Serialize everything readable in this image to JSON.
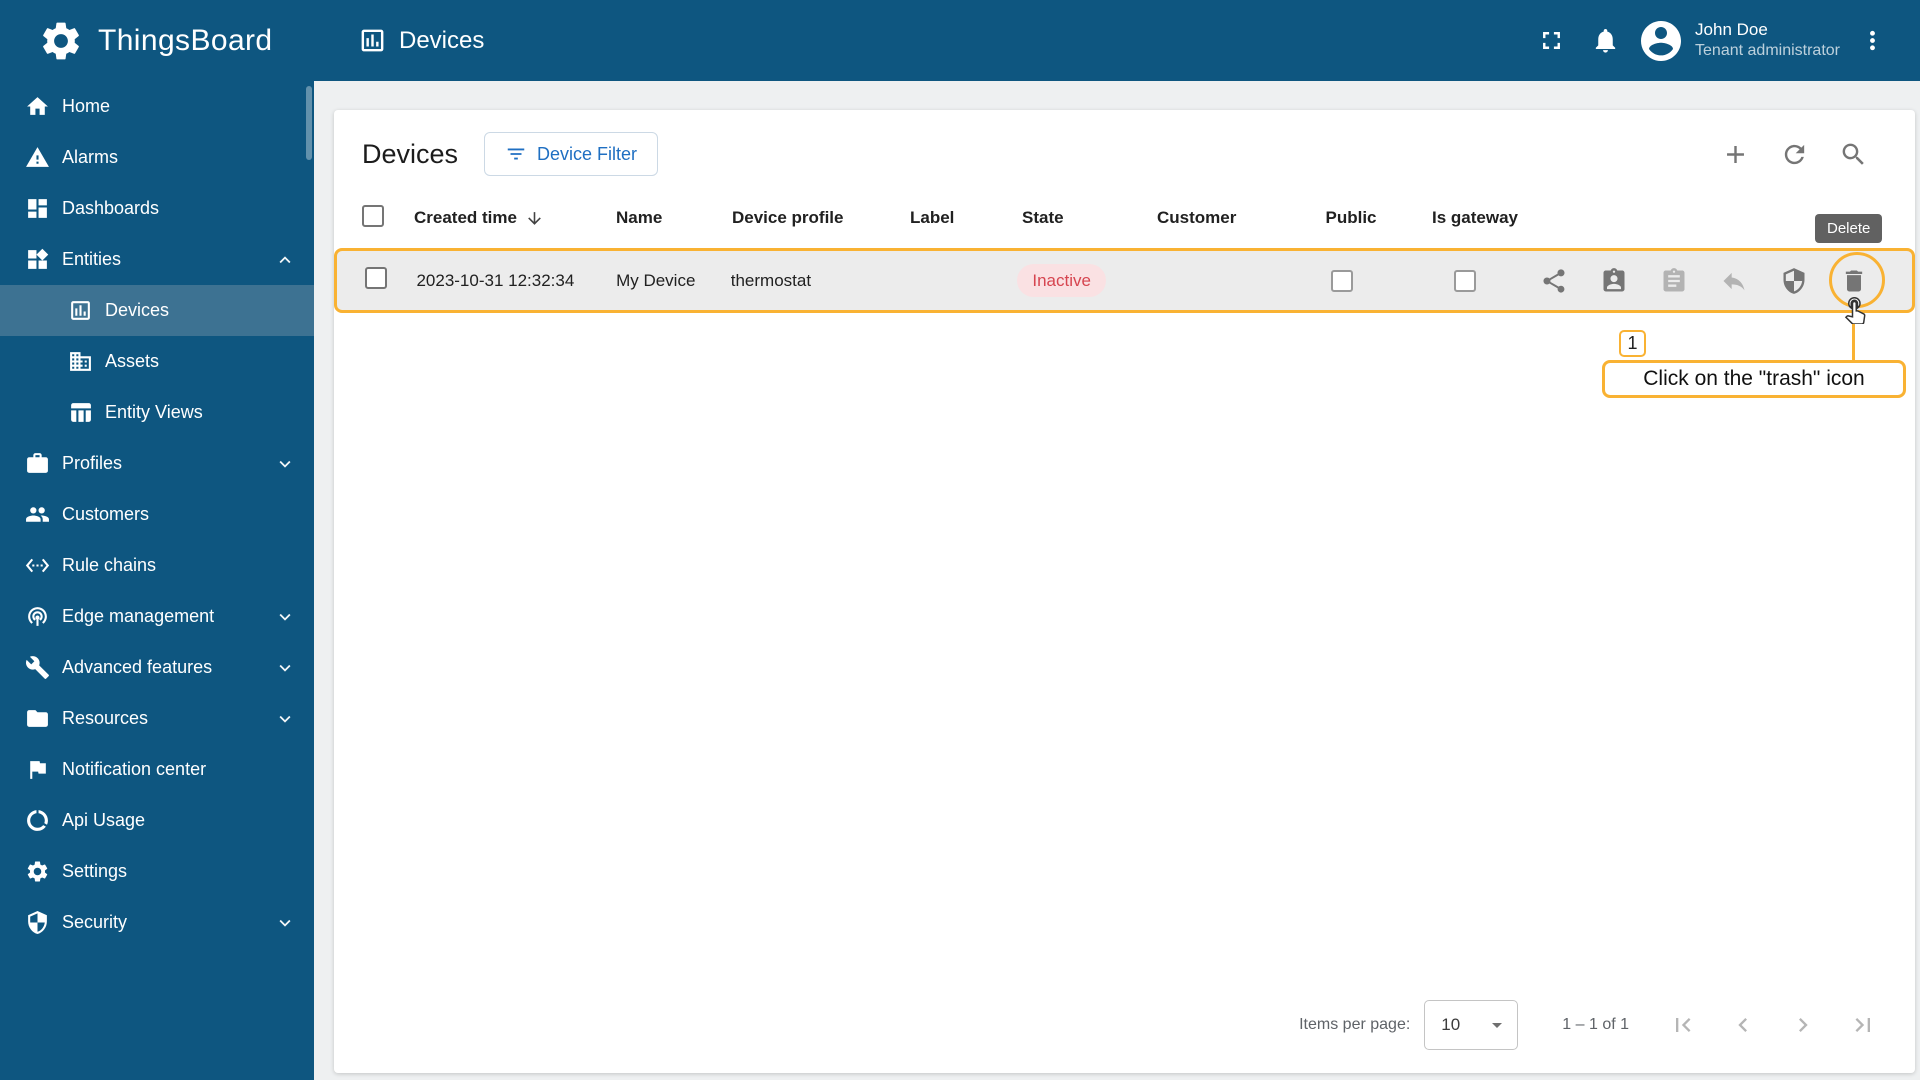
{
  "theme": {
    "primary": "#0e5680",
    "sidebar_selected": "#3d7292",
    "annotation_accent": "#f9b233",
    "state_inactive_bg": "#fae1e3",
    "state_inactive_text": "#d64550",
    "tooltip_bg": "#616161",
    "filter_button_text": "#1f6fc2"
  },
  "app": {
    "name": "ThingsBoard"
  },
  "topbar": {
    "title": "Devices",
    "user": {
      "name": "John Doe",
      "role": "Tenant administrator"
    },
    "icons": [
      "fullscreen-icon",
      "notifications-icon",
      "account-avatar-icon",
      "more-menu-icon"
    ]
  },
  "sidebar": {
    "items": [
      {
        "label": "Home",
        "icon": "home-icon"
      },
      {
        "label": "Alarms",
        "icon": "alarms-icon"
      },
      {
        "label": "Dashboards",
        "icon": "dashboards-icon"
      },
      {
        "label": "Entities",
        "icon": "entities-icon",
        "expanded": true
      },
      {
        "label": "Devices",
        "icon": "devices-icon",
        "child": true,
        "selected": true
      },
      {
        "label": "Assets",
        "icon": "assets-icon",
        "child": true
      },
      {
        "label": "Entity Views",
        "icon": "entity-views-icon",
        "child": true
      },
      {
        "label": "Profiles",
        "icon": "profiles-icon",
        "collapsible": true
      },
      {
        "label": "Customers",
        "icon": "customers-icon"
      },
      {
        "label": "Rule chains",
        "icon": "rule-chains-icon"
      },
      {
        "label": "Edge management",
        "icon": "edge-management-icon",
        "collapsible": true
      },
      {
        "label": "Advanced features",
        "icon": "advanced-features-icon",
        "collapsible": true
      },
      {
        "label": "Resources",
        "icon": "resources-icon",
        "collapsible": true
      },
      {
        "label": "Notification center",
        "icon": "notification-center-icon"
      },
      {
        "label": "Api Usage",
        "icon": "api-usage-icon"
      },
      {
        "label": "Settings",
        "icon": "settings-icon"
      },
      {
        "label": "Security",
        "icon": "security-icon",
        "collapsible": true
      }
    ]
  },
  "main": {
    "title": "Devices",
    "filter_button": "Device Filter",
    "toolbar_icons": [
      "add-icon",
      "refresh-icon",
      "search-icon"
    ],
    "table": {
      "columns": [
        "Created time",
        "Name",
        "Device profile",
        "Label",
        "State",
        "Customer",
        "Public",
        "Is gateway"
      ],
      "sorted_column": "Created time",
      "sort_direction": "desc",
      "rows": [
        {
          "created_time": "2023-10-31 12:32:34",
          "name": "My Device",
          "device_profile": "thermostat",
          "label": "",
          "state": "Inactive",
          "customer": "",
          "public": false,
          "is_gateway": false
        }
      ],
      "row_actions": [
        "share-icon",
        "assign-to-customer-icon",
        "manage-credentials-icon",
        "unassign-icon",
        "security-icon",
        "delete-icon"
      ]
    },
    "pagination": {
      "items_per_page_label": "Items per page:",
      "page_size": "10",
      "range": "1 – 1 of 1"
    }
  },
  "annotation": {
    "step": "1",
    "text": "Click on the \"trash\" icon",
    "tooltip": "Delete"
  }
}
